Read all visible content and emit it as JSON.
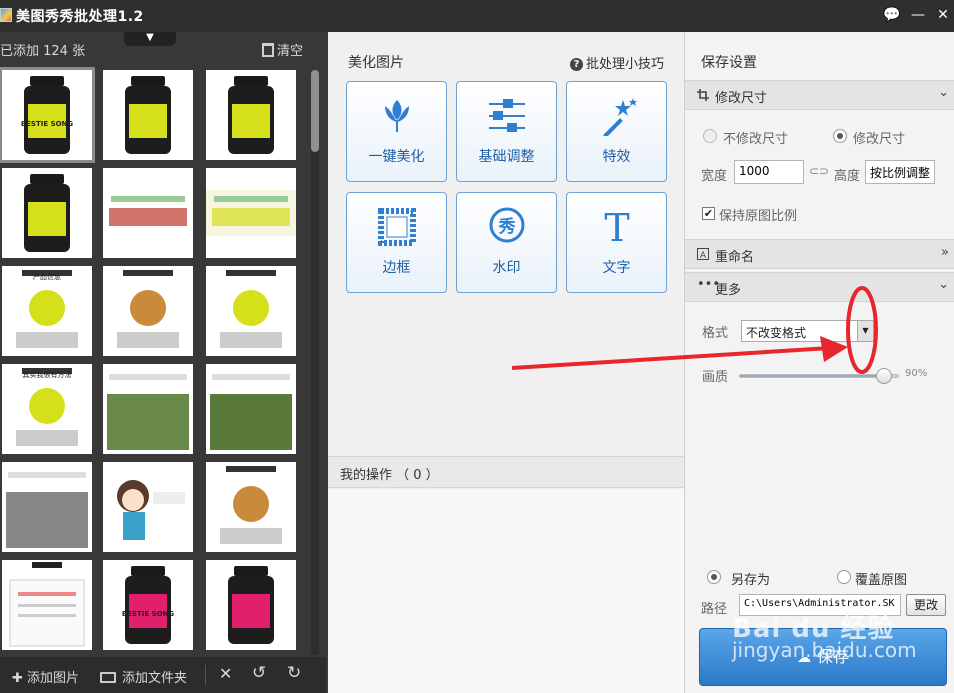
{
  "window": {
    "title": "美图秀秀批处理1.2",
    "buttons": [
      "💬",
      "—",
      "✕"
    ]
  },
  "left_panel": {
    "count_label": "已添加 124 张",
    "clear_label": "清空",
    "bottom": {
      "add_image": "添加图片",
      "add_folder": "添加文件夹"
    }
  },
  "thumbnails": [
    {
      "kind": "jar",
      "label": "BESTIE SONG",
      "color": "#d6e01a"
    },
    {
      "kind": "jar",
      "label": "",
      "color": "#d6e01a"
    },
    {
      "kind": "jar",
      "label": "",
      "color": "#d6e01a"
    },
    {
      "kind": "jar",
      "label": "",
      "color": "#d6e01a"
    },
    {
      "kind": "banner",
      "label": "",
      "color": "#c0392b"
    },
    {
      "kind": "banner2",
      "label": "",
      "color": "#d6e01a"
    },
    {
      "kind": "jarinfo",
      "label": "产品信息",
      "color": "#d6e01a"
    },
    {
      "kind": "poster",
      "label": "",
      "color": "#c98a3a"
    },
    {
      "kind": "poster2",
      "label": "",
      "color": "#d6e01a"
    },
    {
      "kind": "doc",
      "label": "其实我很有方法",
      "color": "#d6e01a"
    },
    {
      "kind": "photo",
      "label": "",
      "color": "#6a8a4a"
    },
    {
      "kind": "photo2",
      "label": "",
      "color": "#5a7a3a"
    },
    {
      "kind": "factory",
      "label": "",
      "color": "#888888"
    },
    {
      "kind": "cartoon",
      "label": "",
      "color": "#3aa0c8"
    },
    {
      "kind": "collage",
      "label": "",
      "color": "#c98a3a"
    },
    {
      "kind": "cert",
      "label": "品牌荣誉",
      "color": "#eeeeee"
    },
    {
      "kind": "jar",
      "label": "BESTIE SONG",
      "color": "#e0206a"
    },
    {
      "kind": "jar",
      "label": "",
      "color": "#e0206a"
    }
  ],
  "middle_panel": {
    "section_title": "美化图片",
    "tips": "批处理小技巧",
    "tools": [
      {
        "label": "一键美化",
        "icon": "tulip-icon"
      },
      {
        "label": "基础调整",
        "icon": "sliders-icon"
      },
      {
        "label": "特效",
        "icon": "magic-wand-icon"
      },
      {
        "label": "边框",
        "icon": "frame-icon"
      },
      {
        "label": "水印",
        "icon": "watermark-icon"
      },
      {
        "label": "文字",
        "icon": "text-icon"
      }
    ],
    "ops_label": "我的操作 （ 0 ）"
  },
  "right_panel": {
    "heading": "保存设置",
    "resize": {
      "title": "修改尺寸",
      "no_resize": "不修改尺寸",
      "resize": "修改尺寸",
      "width_label": "宽度",
      "width_value": "1000",
      "height_label": "高度",
      "height_value": "按比例调整",
      "keep_ratio": "保持原图比例",
      "checkbox_mark": "✔"
    },
    "rename": {
      "title": "重命名"
    },
    "more": {
      "title": "更多",
      "format_label": "格式",
      "format_value": "不改变格式",
      "quality_label": "画质",
      "quality_value": "90%",
      "quality_fraction": 0.9
    },
    "save_as": "另存为",
    "overwrite": "覆盖原图",
    "path_label": "路径",
    "path_value": "C:\\Users\\Administrator.SK",
    "change_btn": "更改",
    "save_btn": "保存"
  },
  "watermark": {
    "line1": "Bai du 经验",
    "line2": "jingyan.baidu.com"
  }
}
